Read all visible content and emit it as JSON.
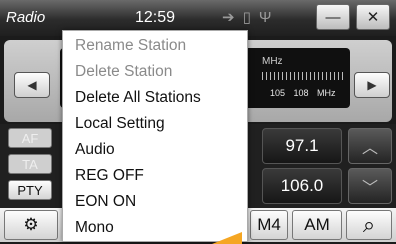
{
  "topbar": {
    "title": "Radio",
    "time": "12:59",
    "status_icons": [
      "radio-signal-icon",
      "phone-icon",
      "usb-icon"
    ],
    "minimize_symbol": "—",
    "close_symbol": "✕"
  },
  "tuner": {
    "band_unit": "MHz",
    "scale_labels": "105 108 MHz",
    "prev_symbol": "◀",
    "next_symbol": "▶"
  },
  "side_buttons": [
    {
      "label": "AF",
      "state": "inactive"
    },
    {
      "label": "TA",
      "state": "inactive"
    },
    {
      "label": "PTY",
      "state": "active"
    }
  ],
  "presets": [
    "97.1",
    "106.0"
  ],
  "scroll": {
    "up_symbol": "︿",
    "down_symbol": "﹀"
  },
  "bottombar": {
    "settings_symbol": "⚙",
    "partial_label": "M4",
    "band_label": "AM",
    "search_symbol": "⌕"
  },
  "menu": {
    "items": [
      {
        "label": "Rename Station",
        "enabled": false
      },
      {
        "label": "Delete Station",
        "enabled": false
      },
      {
        "label": "Delete All Stations",
        "enabled": true
      },
      {
        "label": "Local Setting",
        "enabled": true
      },
      {
        "label": "Audio",
        "enabled": true
      },
      {
        "label": "REG OFF",
        "enabled": true
      },
      {
        "label": "EON ON",
        "enabled": true
      },
      {
        "label": "Mono",
        "enabled": true
      }
    ]
  },
  "colors": {
    "disabled_text": "#8a8a8a",
    "enabled_text": "#111111",
    "accent_pointer": "#f5a623"
  }
}
